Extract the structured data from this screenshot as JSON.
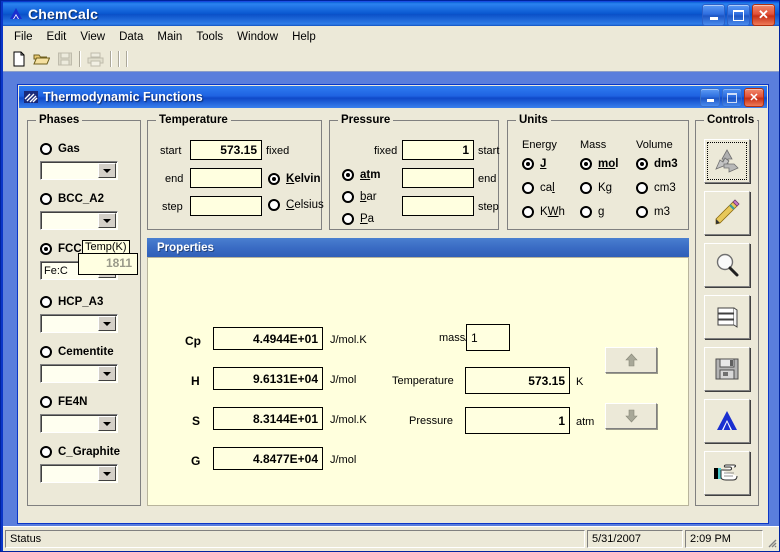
{
  "app": {
    "title": "ChemCalc",
    "title_icon": "blue-triangle-icon",
    "window_buttons": {
      "minimize": "–",
      "maximize": "□",
      "close": "✕"
    }
  },
  "menu": {
    "items": [
      "File",
      "Edit",
      "View",
      "Data",
      "Main",
      "Tools",
      "Window",
      "Help"
    ]
  },
  "toolbar": {
    "buttons": [
      {
        "name": "new-document-icon",
        "enabled": true
      },
      {
        "name": "open-folder-icon",
        "enabled": true
      },
      {
        "name": "save-icon",
        "enabled": false
      },
      {
        "name": "print-icon",
        "enabled": false
      }
    ]
  },
  "child_window": {
    "title": "Thermodynamic Functions",
    "title_icon": "flag-icon"
  },
  "phases": {
    "legend": "Phases",
    "items": [
      {
        "label": "Gas",
        "selected": false,
        "value": ""
      },
      {
        "label": "BCC_A2",
        "selected": false,
        "value": ""
      },
      {
        "label": "FCC",
        "selected": true,
        "value": "Fe:C"
      },
      {
        "label": "HCP_A3",
        "selected": false,
        "value": ""
      },
      {
        "label": "Cementite",
        "selected": false,
        "value": ""
      },
      {
        "label": "FE4N",
        "selected": false,
        "value": ""
      },
      {
        "label": "C_Graphite",
        "selected": false,
        "value": ""
      }
    ]
  },
  "tooltip": {
    "title": "Temp(K)",
    "value": "1811"
  },
  "temperature": {
    "legend": "Temperature",
    "start_label": "start",
    "start_value": "573.15",
    "fixed_label": "fixed",
    "end_label": "end",
    "end_value": "",
    "step_label": "step",
    "step_value": "",
    "scales": [
      {
        "label": "Kelvin",
        "accel": "K",
        "selected": true
      },
      {
        "label": "Celsius",
        "accel": "C",
        "selected": false
      }
    ]
  },
  "pressure": {
    "legend": "Pressure",
    "fixed_label": "fixed",
    "start_label": "start",
    "start_value": "1",
    "end_label": "end",
    "end_value": "",
    "step_label": "step",
    "step_value": "",
    "units": [
      {
        "label": "atm",
        "accel": "a",
        "selected": true
      },
      {
        "label": "bar",
        "accel": "b",
        "selected": false
      },
      {
        "label": "Pa",
        "accel": "P",
        "selected": false
      }
    ]
  },
  "units": {
    "legend": "Units",
    "columns": [
      {
        "header": "Energy",
        "options": [
          {
            "label": "J",
            "selected": true
          },
          {
            "label": "cal",
            "selected": false
          },
          {
            "label": "KWh",
            "selected": false
          }
        ]
      },
      {
        "header": "Mass",
        "options": [
          {
            "label": "mol",
            "selected": true
          },
          {
            "label": "Kg",
            "selected": false
          },
          {
            "label": "g",
            "selected": false
          }
        ]
      },
      {
        "header": "Volume",
        "options": [
          {
            "label": "dm3",
            "selected": true
          },
          {
            "label": "cm3",
            "selected": false
          },
          {
            "label": "m3",
            "selected": false
          }
        ]
      }
    ]
  },
  "properties": {
    "header": "Properties",
    "rows": [
      {
        "symbol": "Cp",
        "value": "4.4944E+01",
        "unit": "J/mol.K"
      },
      {
        "symbol": "H",
        "value": "9.6131E+04",
        "unit": "J/mol"
      },
      {
        "symbol": "S",
        "value": "8.3144E+01",
        "unit": "J/mol.K"
      },
      {
        "symbol": "G",
        "value": "4.8477E+04",
        "unit": "J/mol"
      }
    ],
    "inputs": [
      {
        "label": "mass/mol",
        "value": "1",
        "unit": ""
      },
      {
        "label": "Temperature",
        "value": "573.15",
        "unit": "K"
      },
      {
        "label": "Pressure",
        "value": "1",
        "unit": "atm"
      }
    ],
    "step_buttons": [
      {
        "name": "step-up-button",
        "glyph": "▲",
        "enabled": false
      },
      {
        "name": "step-down-button",
        "glyph": "▼",
        "enabled": false
      }
    ]
  },
  "controls": {
    "legend": "Controls",
    "buttons": [
      {
        "name": "recycle-icon",
        "focused": true
      },
      {
        "name": "pencil-icon",
        "focused": false
      },
      {
        "name": "magnifier-icon",
        "focused": false
      },
      {
        "name": "database-icon",
        "focused": false
      },
      {
        "name": "floppy-disk-icon",
        "focused": false
      },
      {
        "name": "triangle-logo-icon",
        "focused": false
      },
      {
        "name": "pointing-hand-icon",
        "focused": false
      }
    ]
  },
  "status_bar": {
    "status": "Status",
    "date": "5/31/2007",
    "time": "2:09 PM"
  }
}
